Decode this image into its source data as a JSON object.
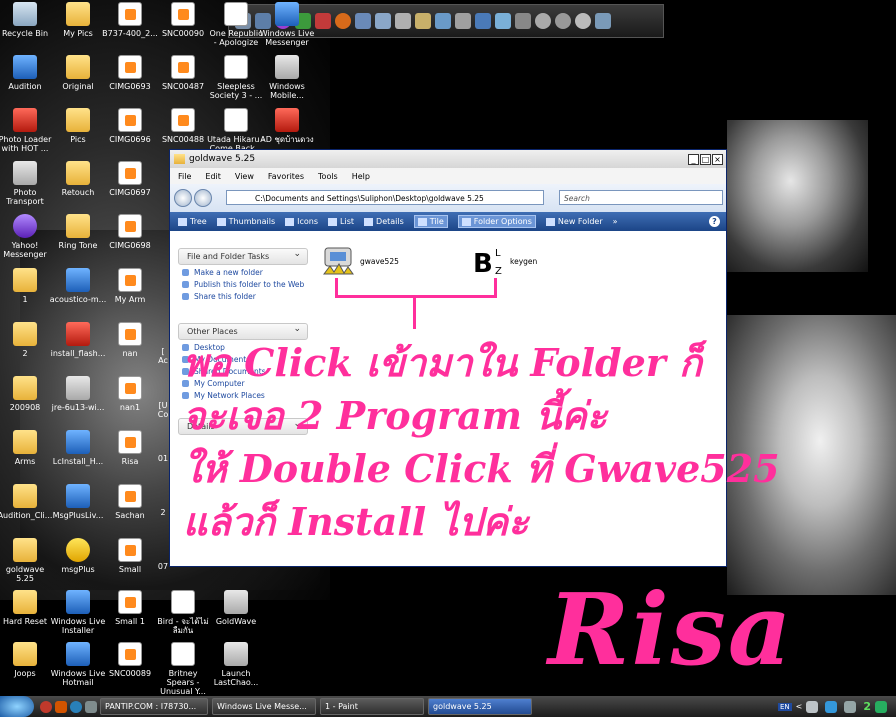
{
  "desktop": {
    "icons": [
      {
        "label": "Recycle Bin",
        "icon": "recycle-bin-icon",
        "type": "bin"
      },
      {
        "label": "My Pics",
        "icon": "folder-icon",
        "type": "folder"
      },
      {
        "label": "B737-400_2...",
        "icon": "image-file-icon",
        "type": "image"
      },
      {
        "label": "SNC00090",
        "icon": "image-file-icon",
        "type": "image"
      },
      {
        "label": "One Republic - Apologize",
        "icon": "music-file-icon",
        "type": "music"
      },
      {
        "label": "Windows Live Messenger",
        "icon": "messenger-icon",
        "type": "app"
      },
      {
        "label": "Audition",
        "icon": "audition-icon",
        "type": "app"
      },
      {
        "label": "Original",
        "icon": "folder-icon",
        "type": "folder"
      },
      {
        "label": "CIMG0693",
        "icon": "image-file-icon",
        "type": "image"
      },
      {
        "label": "SNC00487",
        "icon": "image-file-icon",
        "type": "image"
      },
      {
        "label": "Sleepless Society 3 - ...",
        "icon": "music-file-icon",
        "type": "music"
      },
      {
        "label": "Windows Mobile...",
        "icon": "mobile-icon",
        "type": "gray"
      },
      {
        "label": "Photo Loader with HOT ...",
        "icon": "photo-loader-icon",
        "type": "red"
      },
      {
        "label": "Pics",
        "icon": "folder-icon",
        "type": "folder"
      },
      {
        "label": "CIMG0696",
        "icon": "image-file-icon",
        "type": "image"
      },
      {
        "label": "SNC00488",
        "icon": "image-file-icon",
        "type": "image"
      },
      {
        "label": "Utada Hikaru - Come Back...",
        "icon": "music-file-icon",
        "type": "music"
      },
      {
        "label": "AD ชุดบ้านดวง",
        "icon": "document-icon",
        "type": "red"
      },
      {
        "label": "Photo Transport",
        "icon": "photo-transport-icon",
        "type": "gray"
      },
      {
        "label": "Retouch",
        "icon": "folder-icon",
        "type": "folder"
      },
      {
        "label": "CIMG0697",
        "icon": "image-file-icon",
        "type": "image"
      },
      {
        "label": "Yahoo! Messenger",
        "icon": "yahoo-messenger-icon",
        "type": "purple"
      },
      {
        "label": "Ring Tone",
        "icon": "folder-icon",
        "type": "folder"
      },
      {
        "label": "CIMG0698",
        "icon": "image-file-icon",
        "type": "image"
      },
      {
        "label": "1",
        "icon": "folder-icon",
        "type": "folder"
      },
      {
        "label": "acoustico-m...",
        "icon": "app-icon",
        "type": "app"
      },
      {
        "label": "My Arm",
        "icon": "image-file-icon",
        "type": "image"
      },
      {
        "label": "2",
        "icon": "folder-icon",
        "type": "folder"
      },
      {
        "label": "install_flash...",
        "icon": "flash-icon",
        "type": "red"
      },
      {
        "label": "nan",
        "icon": "image-file-icon",
        "type": "image"
      },
      {
        "label": "200908",
        "icon": "folder-icon",
        "type": "folder"
      },
      {
        "label": "jre-6u13-wi...",
        "icon": "java-icon",
        "type": "gray"
      },
      {
        "label": "nan1",
        "icon": "image-file-icon",
        "type": "image"
      },
      {
        "label": "Arms",
        "icon": "folder-icon",
        "type": "folder"
      },
      {
        "label": "LcInstall_H...",
        "icon": "installer-icon",
        "type": "app"
      },
      {
        "label": "Risa",
        "icon": "image-file-icon",
        "type": "image"
      },
      {
        "label": "Audition_Cli...",
        "icon": "folder-icon",
        "type": "folder"
      },
      {
        "label": "MsgPlusLiv...",
        "icon": "msgplus-icon",
        "type": "app"
      },
      {
        "label": "Sachan",
        "icon": "image-file-icon",
        "type": "image"
      },
      {
        "label": "goldwave 5.25",
        "icon": "folder-icon",
        "type": "folder"
      },
      {
        "label": "msgPlus",
        "icon": "msgplus-smiley-icon",
        "type": "yellow"
      },
      {
        "label": "Small",
        "icon": "image-file-icon",
        "type": "image"
      },
      {
        "label": "Hard Reset",
        "icon": "folder-icon",
        "type": "folder"
      },
      {
        "label": "Windows Live Installer",
        "icon": "windows-live-icon",
        "type": "app"
      },
      {
        "label": "Small 1",
        "icon": "image-file-icon",
        "type": "image"
      },
      {
        "label": "Bird - จะได้ไม่ ลืมกัน",
        "icon": "music-file-icon",
        "type": "music"
      },
      {
        "label": "GoldWave",
        "icon": "goldwave-icon",
        "type": "gray"
      },
      {
        "label": "Joops",
        "icon": "folder-icon",
        "type": "folder"
      },
      {
        "label": "Windows Live Hotmail",
        "icon": "windows-live-icon",
        "type": "app"
      },
      {
        "label": "SNC00089",
        "icon": "image-file-icon",
        "type": "image"
      },
      {
        "label": "Britney Spears - Unusual Y...",
        "icon": "music-file-icon",
        "type": "music"
      },
      {
        "label": "Launch LastChao...",
        "icon": "lastchaos-icon",
        "type": "gray"
      }
    ],
    "partial_labels": [
      "[",
      "Ac",
      "[U",
      "Co",
      "01",
      "2",
      "07"
    ]
  },
  "explorer": {
    "title": "goldwave 5.25",
    "menu": [
      "File",
      "Edit",
      "View",
      "Favorites",
      "Tools",
      "Help"
    ],
    "address": "C:\\Documents and Settings\\Suliphon\\Desktop\\goldwave 5.25",
    "search_placeholder": "Search",
    "toolbar": {
      "tree": "Tree",
      "thumbnails": "Thumbnails",
      "icons": "Icons",
      "list": "List",
      "details": "Details",
      "tile": "Tile",
      "folder_options": "Folder Options",
      "new_folder": "New Folder",
      "more": "»",
      "help": "?"
    },
    "tasks": {
      "header": "File and Folder Tasks",
      "items": [
        "Make a new folder",
        "Publish this folder to the Web",
        "Share this folder"
      ]
    },
    "other_places": {
      "header": "Other Places",
      "items": [
        "Desktop",
        "My Documents",
        "Shared Documents",
        "My Computer",
        "My Network Places"
      ]
    },
    "details_header": "Details",
    "files": [
      {
        "name": "gwave525",
        "icon": "goldwave-installer-icon"
      },
      {
        "name": "keygen",
        "icon": "keygen-icon"
      }
    ]
  },
  "annotation": {
    "lines": [
      "พอ Click เข้ามาใน Folder ก็",
      "จะเจอ 2 Program นี้ค่ะ",
      "ให้ Double Click ที่ Gwave525",
      "แล้วก็ Install ไปค่ะ"
    ],
    "color": "#ff2f9c"
  },
  "watermark": "Risa",
  "taskbar": {
    "tasks": [
      {
        "label": "PANTIP.COM : I78730...",
        "active": false
      },
      {
        "label": "Windows Live Messe...",
        "active": false
      },
      {
        "label": "1 - Paint",
        "active": false
      },
      {
        "label": "goldwave 5.25",
        "active": true
      }
    ],
    "language": "EN",
    "clock": "2"
  },
  "colors": {
    "accent_pink": "#ff2f9c",
    "toolbar_blue": "#1c4587"
  }
}
